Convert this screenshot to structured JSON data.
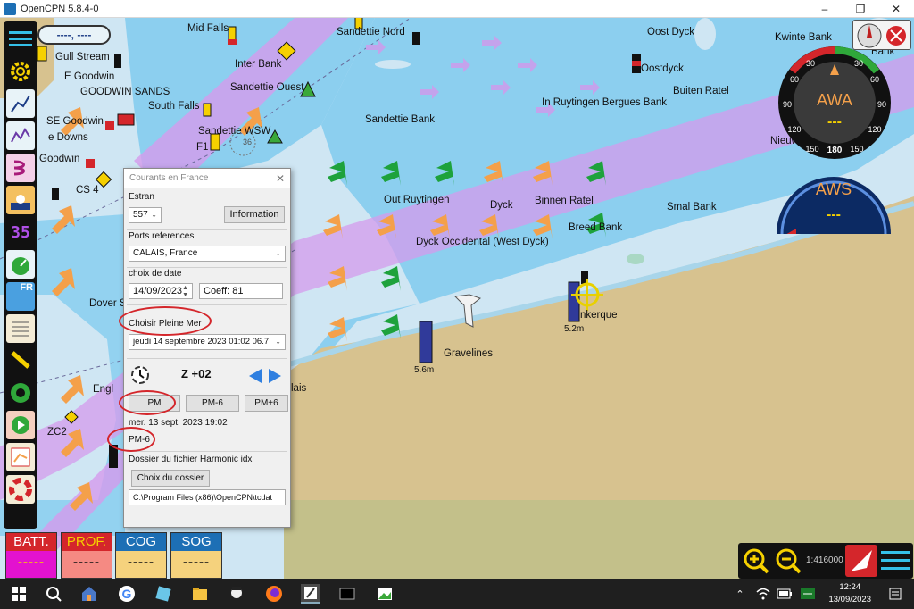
{
  "window": {
    "title": "OpenCPN 5.8.4-0"
  },
  "map_labels": {
    "mid_falls": "Mid Falls",
    "sandettie_nord": "Sandettie Nord",
    "oost_dyck": "Oost Dyck",
    "kwinte_bank": "Kwinte Bank",
    "bank": "Bank",
    "gull_stream": "Gull Stream",
    "inter_bank": "Inter Bank",
    "oostdyck": "Oostdyck",
    "e_goodwin": "E Goodwin",
    "goodwin_sands": "GOODWIN SANDS",
    "sandettie_ouest": "Sandettie Ouest",
    "buiten_ratel": "Buiten Ratel",
    "south_falls": "South Falls",
    "in_ruytingen": "In Ruytingen Bergues Bank",
    "se_goodwin": "SE Goodwin",
    "sandettie_bank": "Sandettie Bank",
    "e_downs": "e Downs",
    "sandettie_wsw": "Sandettie WSW",
    "f1": "F1",
    "depth_36": "36",
    "nieuw": "Nieuw",
    "goodwin": "Goodwin",
    "cs4": "CS 4",
    "out_ruytingen": "Out Ruytingen",
    "dyck": "Dyck",
    "binnen_ratel": "Binnen Ratel",
    "smal_bank": "Smal Bank",
    "breed_bank": "Breed Bank",
    "dyck_occidental": "Dyck Occidental (West Dyck)",
    "dover": "Dover S",
    "dunkerque": "nkerque",
    "height_dunkerque": "5.2m",
    "gravelines": "Gravelines",
    "height_gravelines": "5.6m",
    "calais": "lais",
    "engl": "Engl",
    "zc2": "ZC2"
  },
  "toolbar": {
    "items": [
      {
        "name": "menu-icon"
      },
      {
        "name": "settings-icon"
      },
      {
        "name": "route-icon"
      },
      {
        "name": "track-icon"
      },
      {
        "name": "tide-icon"
      },
      {
        "name": "night-mode-icon"
      },
      {
        "name": "counter-icon",
        "label": "35"
      },
      {
        "name": "dashboard-icon"
      },
      {
        "name": "language-fr-icon",
        "label": "FR"
      },
      {
        "name": "log-icon"
      },
      {
        "name": "pencil-icon"
      },
      {
        "name": "target-icon"
      },
      {
        "name": "play-icon"
      },
      {
        "name": "chart-icon"
      },
      {
        "name": "lifebuoy-icon"
      }
    ],
    "position_readout": "----, ----"
  },
  "gauges": {
    "awa": {
      "label": "AWA",
      "value": "---",
      "bottom_scale": "180"
    },
    "aws": {
      "label": "AWS",
      "value": "---"
    }
  },
  "instruments": [
    {
      "label": "BATT.",
      "value": "-----",
      "bg": "#e312cf"
    },
    {
      "label": "PROF.",
      "value": "-----",
      "bg": "#f58a83"
    },
    {
      "label": "COG",
      "value": "-----",
      "bg": "#f5d27d"
    },
    {
      "label": "SOG",
      "value": "-----",
      "bg": "#f5d27d"
    }
  ],
  "dialog": {
    "title": "Courants en France",
    "estran_label": "Estran",
    "estran_value": "557",
    "information_button": "Information",
    "ports_label": "Ports references",
    "port_value": "CALAIS, France",
    "date_label": "choix de date",
    "date_value": "14/09/2023",
    "coeff_value": "Coeff:  81",
    "pleine_mer_label": "Choisir Pleine Mer",
    "pleine_mer_value": "jeudi 14 septembre 2023 01:02   06.7",
    "zone_label": "Z +02",
    "btn_pm": "PM",
    "btn_pm_minus6": "PM-6",
    "btn_pm_plus6": "PM+6",
    "current_date": "mer. 13 sept. 2023 19:02",
    "current_mode": "PM-6",
    "harmonic_label": "Dossier du fichier Harmonic idx",
    "choose_folder_button": "Choix du dossier",
    "folder_path": "C:\\Program Files (x86)\\OpenCPN\\tcdat"
  },
  "zoom": {
    "scale": "1:416000"
  },
  "taskbar": {
    "time": "12:24",
    "date": "13/09/2023"
  },
  "colors": {
    "deep_water": "#8ccfef",
    "shallow_water": "#cfe6f3",
    "land": "#d7c28f",
    "traffic_lane": "#d49bec",
    "current_orange": "#f4a04a",
    "current_green": "#1ea23c",
    "highlight": "#d4262b"
  }
}
